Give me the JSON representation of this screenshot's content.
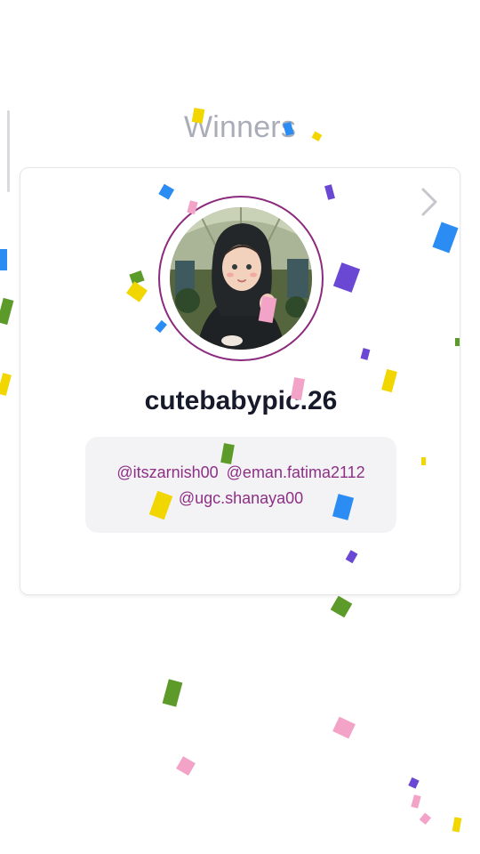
{
  "header": {
    "title": "Winners"
  },
  "winner_card": {
    "username": "cutebabypic.26",
    "avatar_icon": "avatar-illustration-icon",
    "next_icon": "chevron-right-icon",
    "ring_color": "#8c2a7e",
    "tagged_users": [
      "@itszarnish00",
      "@eman.fatima2112",
      "@ugc.shanaya00"
    ]
  },
  "colors": {
    "title": "#a9adb8",
    "username": "#171a2b",
    "tags": "#8e2f86",
    "tags_background": "#f3f3f5",
    "confetti": [
      "#2b8cf3",
      "#f2d600",
      "#6a48d4",
      "#5c9a2a",
      "#f3a3c8"
    ]
  }
}
